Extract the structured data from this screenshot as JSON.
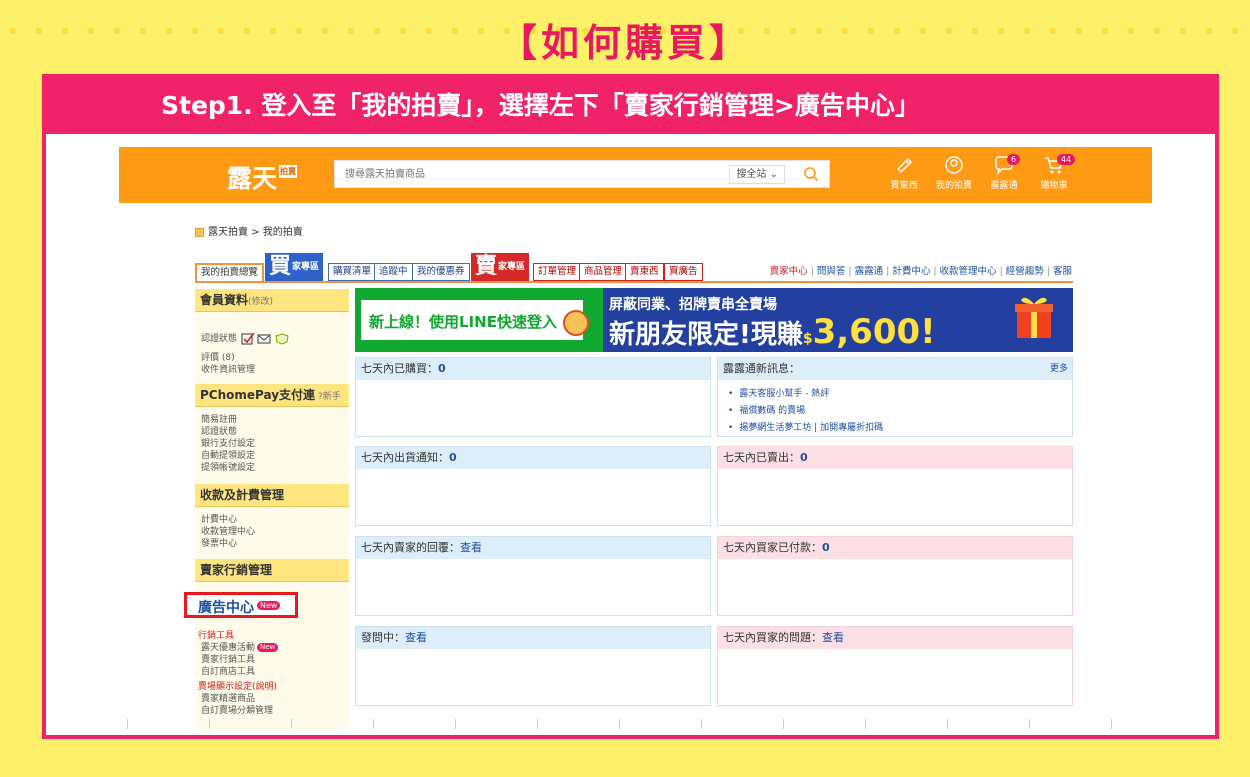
{
  "heading": "【如何購買】",
  "step": "Step1. 登入至「我的拍賣」，選擇左下「賣家行銷管理>廣告中心」",
  "site": {
    "logo": "露天",
    "logo_badge": "拍賣",
    "search_placeholder": "搜尋露天拍賣商品",
    "search_scope": "搜全站",
    "top_icons": [
      {
        "label": "賣東西",
        "icon": "sell-icon"
      },
      {
        "label": "我的拍賣",
        "icon": "user-icon"
      },
      {
        "label": "露露通",
        "icon": "chat-icon",
        "badge": "6"
      },
      {
        "label": "購物車",
        "icon": "cart-icon",
        "badge": "44"
      }
    ]
  },
  "breadcrumb": {
    "home": "露天拍賣",
    "sep": " > ",
    "current": "我的拍賣"
  },
  "tabs": {
    "overview": "我的拍賣總覽",
    "buy_big": "買",
    "buy_small": "家專區",
    "buy_items": [
      "購買清單",
      "追蹤中",
      "我的優惠券"
    ],
    "sell_big": "賣",
    "sell_small": "家專區",
    "sell_items": [
      "訂單管理",
      "商品管理",
      "賣東西",
      "買廣告"
    ]
  },
  "toplinks": [
    "賣家中心",
    "問與答",
    "露露通",
    "計費中心",
    "收款管理中心",
    "經營趨勢",
    "客服"
  ],
  "sidebar": {
    "member_title": "會員資料",
    "member_edit": "(修改)",
    "member_links": [
      "認證狀態",
      "評價 (8)",
      "收件資訊管理"
    ],
    "pay_title": "PChomePay支付連",
    "pay_help": "新手",
    "pay_links": [
      "簡易註冊",
      "認證狀態",
      "銀行支付設定",
      "自動提領設定",
      "提領帳號設定"
    ],
    "billing_title": "收款及計費管理",
    "billing_links": [
      "計費中心",
      "收款管理中心",
      "發票中心"
    ],
    "marketing_title": "賣家行銷管理",
    "ad_center": "廣告中心",
    "new_tag": "New",
    "tools_title": "行銷工具",
    "tools_links": [
      "露天優惠活動",
      "賣家行銷工具",
      "自訂商店工具"
    ],
    "display_title": "賣場顯示設定(說明)",
    "display_links": [
      "賣家精選商品",
      "自訂賣場分類管理"
    ]
  },
  "banner": {
    "left_text": "新上線！使用LINE快速登入",
    "right_line1": "屏蔽同業、招牌賣串全賣場",
    "right_line2_prefix": "新朋友限定!現賺",
    "currency": "$",
    "amount": "3,600",
    "suffix": "!"
  },
  "panels": {
    "bought": {
      "label": "七天內已購買：",
      "value": "0"
    },
    "news": {
      "label": "露露通新訊息：",
      "more": "更多",
      "items": [
        "露天客服小幫手 - 熱評",
        "福償數碼 的賣場",
        "揚夢網生活夢工坊 | 加開專屬折扣碼"
      ]
    },
    "ship": {
      "label": "七天內出貨通知：",
      "value": "0"
    },
    "sold": {
      "label": "七天內已賣出：",
      "value": "0"
    },
    "reply": {
      "label": "七天內賣家的回覆：",
      "link": "查看"
    },
    "paid": {
      "label": "七天內買家已付款：",
      "value": "0"
    },
    "asking": {
      "label": "發問中：",
      "link": "查看"
    },
    "questions": {
      "label": "七天內買家的問題：",
      "link": "查看"
    }
  },
  "colors": {
    "brand_orange": "#FF9A14",
    "accent_pink": "#F0226A",
    "title_pink": "#E8195E",
    "bg_yellow": "#FFF06A",
    "link_blue": "#1f4fa0",
    "highlight_red": "#E8191E"
  }
}
